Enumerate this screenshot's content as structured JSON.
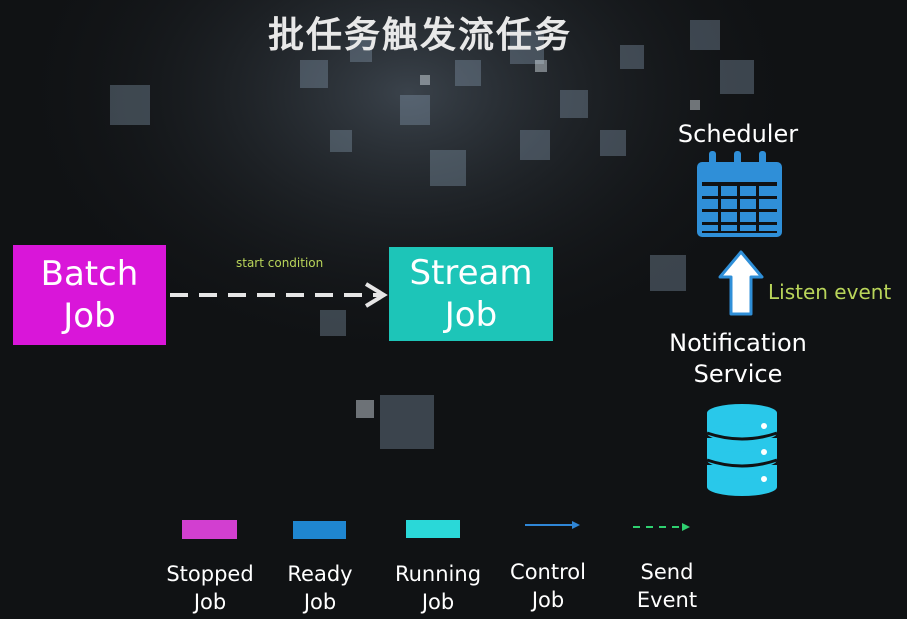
{
  "title": "批任务触发流任务",
  "nodes": {
    "batch_job": "Batch\nJob",
    "stream_job": "Stream\nJob",
    "scheduler": "Scheduler",
    "notification_service": "Notification\nService"
  },
  "edges": {
    "start_condition": "start condition",
    "listen_event": "Listen event"
  },
  "legend": [
    {
      "label": "Stopped\nJob",
      "color": "#d23fd0",
      "kind": "box"
    },
    {
      "label": "Ready\nJob",
      "color": "#1f86d0",
      "kind": "box"
    },
    {
      "label": "Running\nJob",
      "color": "#2ad8d8",
      "kind": "box"
    },
    {
      "label": "Control\nJob",
      "color": "#2f86d6",
      "kind": "solid-arrow"
    },
    {
      "label": "Send\nEvent",
      "color": "#2fd070",
      "kind": "dashed-arrow"
    }
  ],
  "colors": {
    "batch": "#d916d9",
    "stream": "#1dc5b8",
    "icon_blue": "#2f8fd8",
    "database_cyan": "#29c8ea",
    "accent_green": "#b9d55a"
  },
  "icons": [
    "calendar-icon",
    "up-arrow-icon",
    "database-icon",
    "dashed-arrow-icon"
  ]
}
